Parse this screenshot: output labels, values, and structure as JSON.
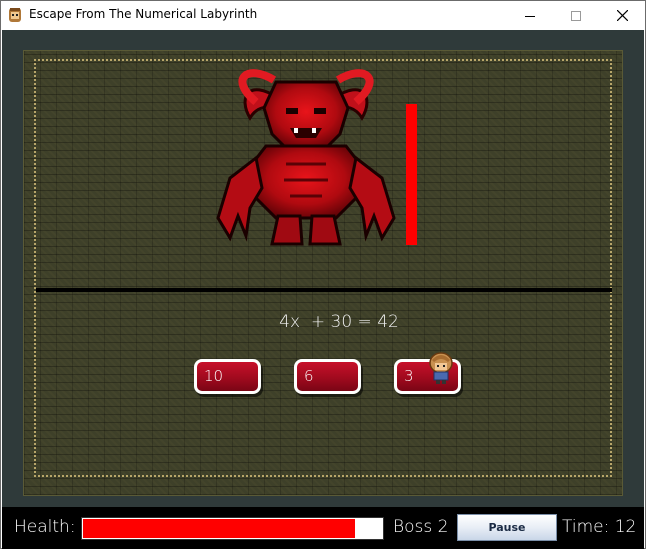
{
  "window": {
    "title": "Escape From The Numerical Labyrinth",
    "controls": [
      "minimize-icon",
      "maximize-icon",
      "close-icon"
    ]
  },
  "battle": {
    "enemy": "demon-boss-icon",
    "enemy_health_fraction": 1.0,
    "equation": "4x  + 30 = 42",
    "answers": [
      "10",
      "6",
      "3"
    ],
    "player_position": "answer-3"
  },
  "hud": {
    "health_label": "Health:",
    "health_fraction": 0.91,
    "boss_label": "Boss 2",
    "pause_label": "Pause",
    "time_label": "Time: 12"
  },
  "colors": {
    "accent_red": "#ff0000",
    "answer_red": "#b00c22",
    "wall_olive": "#3e4029",
    "frame_bg": "#2f3a3a",
    "hud_bg": "#000000"
  }
}
